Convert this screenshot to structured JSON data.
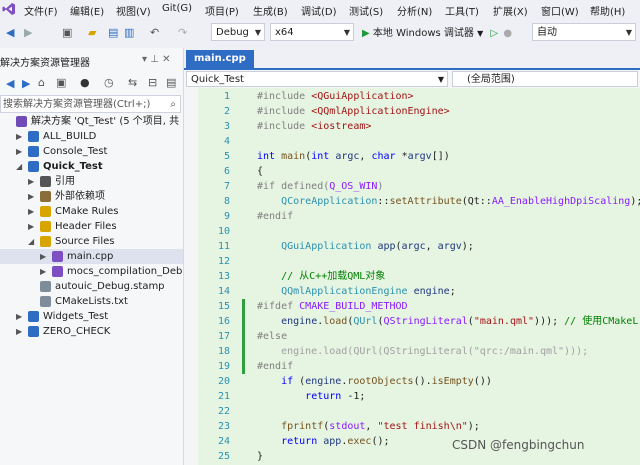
{
  "menu": [
    "文件(F)",
    "编辑(E)",
    "视图(V)",
    "Git(G)",
    "项目(P)",
    "生成(B)",
    "调试(D)",
    "测试(S)",
    "分析(N)",
    "工具(T)",
    "扩展(X)",
    "窗口(W)",
    "帮助(H)"
  ],
  "toolbar": {
    "config": "Debug",
    "platform": "x64",
    "run_label": "本地 Windows 调试器",
    "auto": "自动"
  },
  "solution_explorer": {
    "title": "解决方案资源管理器",
    "search_placeholder": "搜索解决方案资源管理器(Ctrl+;)",
    "items": [
      {
        "label": "解决方案 'Qt_Test' (5 个项目, 共 5 个",
        "indent": 0,
        "caret": "",
        "icon": "solution-icon"
      },
      {
        "label": "ALL_BUILD",
        "indent": 1,
        "caret": "▶",
        "icon": "project-icon"
      },
      {
        "label": "Console_Test",
        "indent": 1,
        "caret": "▶",
        "icon": "project-icon"
      },
      {
        "label": "Quick_Test",
        "indent": 1,
        "caret": "◢",
        "icon": "project-icon"
      },
      {
        "label": "引用",
        "indent": 2,
        "caret": "▶",
        "icon": "references-icon"
      },
      {
        "label": "外部依赖项",
        "indent": 2,
        "caret": "▶",
        "icon": "external-deps-icon"
      },
      {
        "label": "CMake Rules",
        "indent": 2,
        "caret": "▶",
        "icon": "folder-icon"
      },
      {
        "label": "Header Files",
        "indent": 2,
        "caret": "▶",
        "icon": "folder-icon"
      },
      {
        "label": "Source Files",
        "indent": 2,
        "caret": "◢",
        "icon": "folder-icon"
      },
      {
        "label": "main.cpp",
        "indent": 3,
        "caret": "▶",
        "icon": "cpp-file-icon"
      },
      {
        "label": "mocs_compilation_Debug",
        "indent": 3,
        "caret": "▶",
        "icon": "cpp-file-icon"
      },
      {
        "label": "autouic_Debug.stamp",
        "indent": 2,
        "caret": "",
        "icon": "file-icon"
      },
      {
        "label": "CMakeLists.txt",
        "indent": 2,
        "caret": "",
        "icon": "file-icon"
      },
      {
        "label": "Widgets_Test",
        "indent": 1,
        "caret": "▶",
        "icon": "project-icon"
      },
      {
        "label": "ZERO_CHECK",
        "indent": 1,
        "caret": "▶",
        "icon": "project-icon"
      }
    ]
  },
  "editor": {
    "tab": "main.cpp",
    "scope_left": "Quick_Test",
    "scope_right": "(全局范围)",
    "line_numbers": [
      "1",
      "2",
      "3",
      "4",
      "5",
      "6",
      "7",
      "8",
      "9",
      "10",
      "11",
      "12",
      "13",
      "14",
      "15",
      "16",
      "17",
      "18",
      "19",
      "20",
      "21",
      "22",
      "23",
      "24",
      "25"
    ]
  },
  "watermark": "CSDN @fengbingchun",
  "colors": {
    "accent": "#2f6cc4",
    "changed_bg": "#e6f4e2",
    "change_bar": "#2e9e3f"
  }
}
